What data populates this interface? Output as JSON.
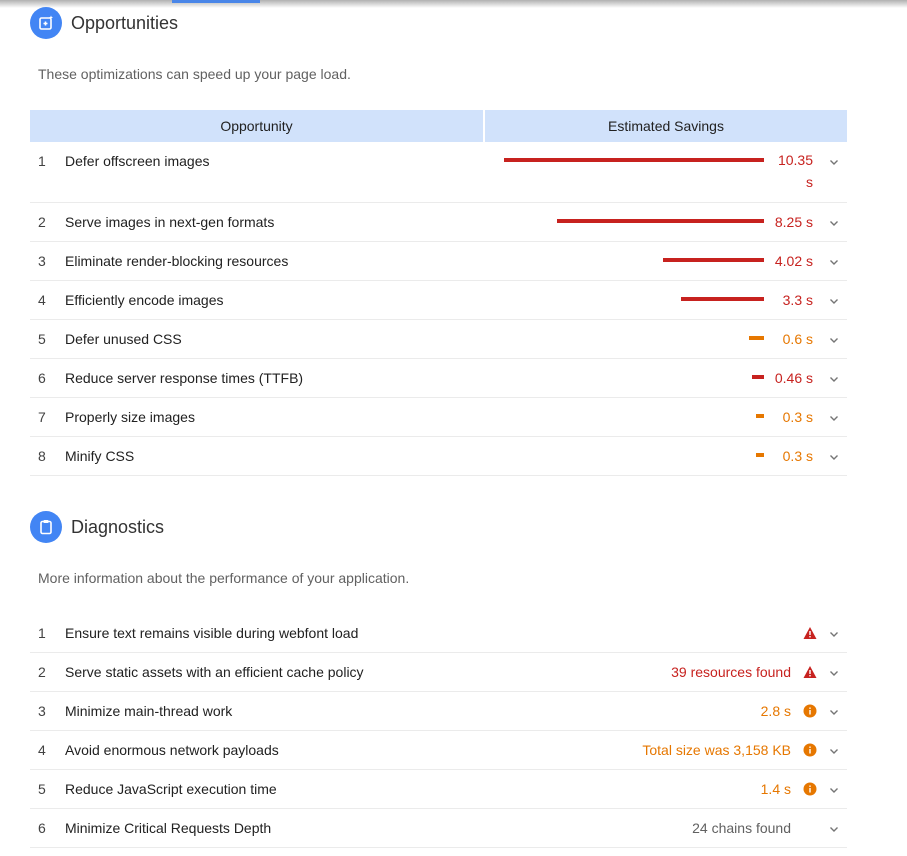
{
  "colors": {
    "fail": "#c7221f",
    "average": "#e67700",
    "accent": "#4285f4",
    "header_bg": "#d1e2fb"
  },
  "opportunities": {
    "title": "Opportunities",
    "icon": "opportunity-icon",
    "description": "These optimizations can speed up your page load.",
    "columns": [
      "Opportunity",
      "Estimated Savings"
    ],
    "items": [
      {
        "index": "1",
        "title": "Defer offscreen images",
        "savings": "10.35 s",
        "savings_line1": "10.35",
        "savings_line2": "s",
        "seconds": 10.35,
        "severity": "fail"
      },
      {
        "index": "2",
        "title": "Serve images in next-gen formats",
        "savings": "8.25 s",
        "seconds": 8.25,
        "severity": "fail"
      },
      {
        "index": "3",
        "title": "Eliminate render-blocking resources",
        "savings": "4.02 s",
        "seconds": 4.02,
        "severity": "fail"
      },
      {
        "index": "4",
        "title": "Efficiently encode images",
        "savings": "3.3 s",
        "seconds": 3.3,
        "severity": "fail"
      },
      {
        "index": "5",
        "title": "Defer unused CSS",
        "savings": "0.6 s",
        "seconds": 0.6,
        "severity": "average"
      },
      {
        "index": "6",
        "title": "Reduce server response times (TTFB)",
        "savings": "0.46 s",
        "seconds": 0.46,
        "severity": "fail"
      },
      {
        "index": "7",
        "title": "Properly size images",
        "savings": "0.3 s",
        "seconds": 0.3,
        "severity": "average"
      },
      {
        "index": "8",
        "title": "Minify CSS",
        "savings": "0.3 s",
        "seconds": 0.3,
        "severity": "average"
      }
    ]
  },
  "diagnostics": {
    "title": "Diagnostics",
    "icon": "clipboard-icon",
    "description": "More information about the performance of your application.",
    "items": [
      {
        "index": "1",
        "title": "Ensure text remains visible during webfont load",
        "value": "",
        "severity": "fail",
        "status_icon": "warning-triangle-icon"
      },
      {
        "index": "2",
        "title": "Serve static assets with an efficient cache policy",
        "value": "39 resources found",
        "severity": "fail",
        "status_icon": "warning-triangle-icon"
      },
      {
        "index": "3",
        "title": "Minimize main-thread work",
        "value": "2.8 s",
        "severity": "average",
        "status_icon": "info-circle-icon"
      },
      {
        "index": "4",
        "title": "Avoid enormous network payloads",
        "value": "Total size was 3,158 KB",
        "severity": "average",
        "status_icon": "info-circle-icon"
      },
      {
        "index": "5",
        "title": "Reduce JavaScript execution time",
        "value": "1.4 s",
        "severity": "average",
        "status_icon": "info-circle-icon"
      },
      {
        "index": "6",
        "title": "Minimize Critical Requests Depth",
        "value": "24 chains found",
        "severity": "neutral",
        "status_icon": ""
      }
    ]
  }
}
